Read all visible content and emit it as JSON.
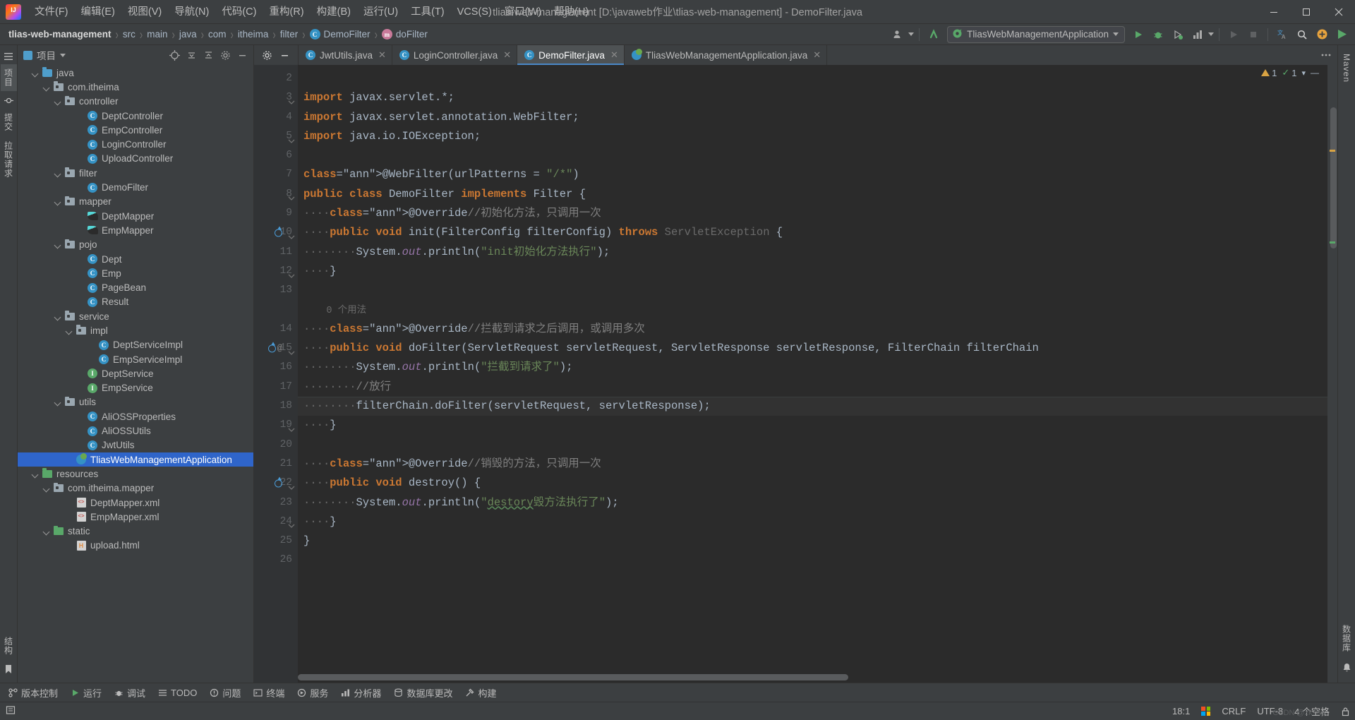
{
  "titlebar": {
    "logo_name": "intellij-idea-logo",
    "menus": [
      {
        "label": "文件(F)",
        "name": "menu-file"
      },
      {
        "label": "编辑(E)",
        "name": "menu-edit"
      },
      {
        "label": "视图(V)",
        "name": "menu-view"
      },
      {
        "label": "导航(N)",
        "name": "menu-navigate"
      },
      {
        "label": "代码(C)",
        "name": "menu-code"
      },
      {
        "label": "重构(R)",
        "name": "menu-refactor"
      },
      {
        "label": "构建(B)",
        "name": "menu-build"
      },
      {
        "label": "运行(U)",
        "name": "menu-run"
      },
      {
        "label": "工具(T)",
        "name": "menu-tools"
      },
      {
        "label": "VCS(S)",
        "name": "menu-vcs"
      },
      {
        "label": "窗口(W)",
        "name": "menu-window"
      },
      {
        "label": "帮助(H)",
        "name": "menu-help"
      }
    ],
    "project_title": "tlias-web-management [D:\\javaweb作业\\tlias-web-management] - DemoFilter.java"
  },
  "navbar": {
    "breadcrumbs": [
      {
        "label": "tlias-web-management",
        "icon": "",
        "name": "breadcrumb-project"
      },
      {
        "label": "src",
        "icon": "",
        "name": "breadcrumb-src"
      },
      {
        "label": "main",
        "icon": "",
        "name": "breadcrumb-main"
      },
      {
        "label": "java",
        "icon": "",
        "name": "breadcrumb-java"
      },
      {
        "label": "com",
        "icon": "",
        "name": "breadcrumb-com"
      },
      {
        "label": "itheima",
        "icon": "",
        "name": "breadcrumb-itheima"
      },
      {
        "label": "filter",
        "icon": "",
        "name": "breadcrumb-filter"
      },
      {
        "label": "DemoFilter",
        "icon": "C",
        "name": "breadcrumb-class"
      },
      {
        "label": "doFilter",
        "icon": "m",
        "name": "breadcrumb-method"
      }
    ],
    "separator": "›",
    "run_config": "TliasWebManagementApplication",
    "icons": {
      "account": "account-icon",
      "updates": "update-arrow-icon",
      "spring_boot": "spring-boot-icon",
      "run": "run-icon",
      "debug": "debug-icon",
      "run_with_coverage": "coverage-icon",
      "profiler": "profiler-icon",
      "rerun": "rerun-icon",
      "stop": "stop-icon",
      "translate": "translate-icon",
      "search": "search-icon",
      "plugins": "plugin-icon",
      "play_green": "play-green-icon",
      "dropdown": "chevron-down-icon"
    }
  },
  "left_strip": {
    "tabs": [
      {
        "label": "项目",
        "name": "tool-tab-project",
        "active": true
      },
      {
        "label": "提交",
        "name": "tool-tab-commit",
        "active": false
      },
      {
        "label": "拉取请求",
        "name": "tool-tab-pull-requests",
        "active": false
      }
    ],
    "bottom": [
      {
        "label": "结构",
        "name": "tool-tab-structure"
      },
      {
        "label": "收藏夹",
        "name": "tool-tab-bookmarks"
      }
    ]
  },
  "right_strip": {
    "tabs": [
      {
        "label": "Maven",
        "name": "tool-tab-maven"
      },
      {
        "label": "数据库",
        "name": "tool-tab-database"
      },
      {
        "label": "通知",
        "name": "tool-tab-notifications"
      }
    ]
  },
  "project_panel": {
    "title": "项目",
    "actions": [
      {
        "name": "select-opened-file-button",
        "icon": "crosshair-icon"
      },
      {
        "name": "expand-all-button",
        "icon": "expand-all-icon"
      },
      {
        "name": "collapse-all-button",
        "icon": "collapse-all-icon"
      },
      {
        "name": "settings-button",
        "icon": "gear-icon"
      },
      {
        "name": "hide-button",
        "icon": "minimize-icon"
      }
    ],
    "tree": [
      {
        "label": "java",
        "icon": "folder-src",
        "indent": 4,
        "arrow": true,
        "selected": false
      },
      {
        "label": "com.itheima",
        "icon": "folder-pkg",
        "indent": 5,
        "arrow": true,
        "selected": false
      },
      {
        "label": "controller",
        "icon": "folder-pkg",
        "indent": 6,
        "arrow": true,
        "selected": false
      },
      {
        "label": "DeptController",
        "icon": "class",
        "indent": 8,
        "arrow": false,
        "selected": false
      },
      {
        "label": "EmpController",
        "icon": "class",
        "indent": 8,
        "arrow": false,
        "selected": false
      },
      {
        "label": "LoginController",
        "icon": "class",
        "indent": 8,
        "arrow": false,
        "selected": false
      },
      {
        "label": "UploadController",
        "icon": "class",
        "indent": 8,
        "arrow": false,
        "selected": false
      },
      {
        "label": "filter",
        "icon": "folder-pkg",
        "indent": 6,
        "arrow": true,
        "selected": false
      },
      {
        "label": "DemoFilter",
        "icon": "class",
        "indent": 8,
        "arrow": false,
        "selected": false
      },
      {
        "label": "mapper",
        "icon": "folder-pkg",
        "indent": 6,
        "arrow": true,
        "selected": false
      },
      {
        "label": "DeptMapper",
        "icon": "mapper",
        "indent": 8,
        "arrow": false,
        "selected": false
      },
      {
        "label": "EmpMapper",
        "icon": "mapper",
        "indent": 8,
        "arrow": false,
        "selected": false
      },
      {
        "label": "pojo",
        "icon": "folder-pkg",
        "indent": 6,
        "arrow": true,
        "selected": false
      },
      {
        "label": "Dept",
        "icon": "class",
        "indent": 8,
        "arrow": false,
        "selected": false
      },
      {
        "label": "Emp",
        "icon": "class",
        "indent": 8,
        "arrow": false,
        "selected": false
      },
      {
        "label": "PageBean",
        "icon": "class",
        "indent": 8,
        "arrow": false,
        "selected": false
      },
      {
        "label": "Result",
        "icon": "class",
        "indent": 8,
        "arrow": false,
        "selected": false
      },
      {
        "label": "service",
        "icon": "folder-pkg",
        "indent": 6,
        "arrow": true,
        "selected": false
      },
      {
        "label": "impl",
        "icon": "folder-pkg",
        "indent": 7,
        "arrow": true,
        "selected": false
      },
      {
        "label": "DeptServiceImpl",
        "icon": "class",
        "indent": 9,
        "arrow": false,
        "selected": false
      },
      {
        "label": "EmpServiceImpl",
        "icon": "class",
        "indent": 9,
        "arrow": false,
        "selected": false
      },
      {
        "label": "DeptService",
        "icon": "interface",
        "indent": 8,
        "arrow": false,
        "selected": false
      },
      {
        "label": "EmpService",
        "icon": "interface",
        "indent": 8,
        "arrow": false,
        "selected": false
      },
      {
        "label": "utils",
        "icon": "folder-pkg",
        "indent": 6,
        "arrow": true,
        "selected": false
      },
      {
        "label": "AliOSSProperties",
        "icon": "class",
        "indent": 8,
        "arrow": false,
        "selected": false
      },
      {
        "label": "AliOSSUtils",
        "icon": "class",
        "indent": 8,
        "arrow": false,
        "selected": false
      },
      {
        "label": "JwtUtils",
        "icon": "class",
        "indent": 8,
        "arrow": false,
        "selected": false
      },
      {
        "label": "TliasWebManagementApplication",
        "icon": "spring",
        "indent": 7,
        "arrow": false,
        "selected": true
      },
      {
        "label": "resources",
        "icon": "folder-res",
        "indent": 4,
        "arrow": true,
        "selected": false
      },
      {
        "label": "com.itheima.mapper",
        "icon": "folder-pkg",
        "indent": 5,
        "arrow": true,
        "selected": false
      },
      {
        "label": "DeptMapper.xml",
        "icon": "xml",
        "indent": 7,
        "arrow": false,
        "selected": false
      },
      {
        "label": "EmpMapper.xml",
        "icon": "xml",
        "indent": 7,
        "arrow": false,
        "selected": false
      },
      {
        "label": "static",
        "icon": "folder-res",
        "indent": 5,
        "arrow": true,
        "selected": false
      },
      {
        "label": "upload.html",
        "icon": "html",
        "indent": 7,
        "arrow": false,
        "selected": false
      }
    ]
  },
  "editor": {
    "tabs": [
      {
        "label": "JwtUtils.java",
        "icon": "java-class-icon",
        "active": false,
        "name": "editor-tab-jwtutils"
      },
      {
        "label": "LoginController.java",
        "icon": "java-class-icon",
        "active": false,
        "name": "editor-tab-logincontroller"
      },
      {
        "label": "DemoFilter.java",
        "icon": "java-class-icon",
        "active": true,
        "name": "editor-tab-demofilter"
      },
      {
        "label": "TliasWebManagementApplication.java",
        "icon": "spring-class-icon",
        "active": false,
        "name": "editor-tab-tliaswebmanagementapplication"
      }
    ],
    "inspection": {
      "warnings": "1",
      "checks": "1"
    },
    "usage_hint": "0 个用法",
    "lines": [
      {
        "num": "2",
        "text": ""
      },
      {
        "num": "3",
        "text": "import javax.servlet.*;"
      },
      {
        "num": "4",
        "text": "import javax.servlet.annotation.WebFilter;"
      },
      {
        "num": "5",
        "text": "import java.io.IOException;"
      },
      {
        "num": "6",
        "text": ""
      },
      {
        "num": "7",
        "text": "@WebFilter(urlPatterns = \"/*\")"
      },
      {
        "num": "8",
        "text": "public class DemoFilter implements Filter {"
      },
      {
        "num": "9",
        "text": "    @Override//初始化方法，只调用一次"
      },
      {
        "num": "10",
        "text": "    public void init(FilterConfig filterConfig) throws ServletException {"
      },
      {
        "num": "11",
        "text": "        System.out.println(\"init初始化方法执行\");"
      },
      {
        "num": "12",
        "text": "    }"
      },
      {
        "num": "13",
        "text": ""
      },
      {
        "num": "",
        "text": "    0 个用法"
      },
      {
        "num": "14",
        "text": "    @Override//拦截到请求之后调用，或调用多次"
      },
      {
        "num": "15",
        "text": "    public void doFilter(ServletRequest servletRequest, ServletResponse servletResponse, FilterChain filterChain"
      },
      {
        "num": "16",
        "text": "        System.out.println(\"拦截到请求了\");"
      },
      {
        "num": "17",
        "text": "        //放行"
      },
      {
        "num": "18",
        "text": "        filterChain.doFilter(servletRequest, servletResponse);"
      },
      {
        "num": "19",
        "text": "    }"
      },
      {
        "num": "20",
        "text": ""
      },
      {
        "num": "21",
        "text": "    @Override//销毁的方法，只调用一次"
      },
      {
        "num": "22",
        "text": "    public void destroy() {"
      },
      {
        "num": "23",
        "text": "        System.out.println(\"destory销毁方法执行了\");"
      },
      {
        "num": "24",
        "text": "    }"
      },
      {
        "num": "25",
        "text": "}"
      },
      {
        "num": "26",
        "text": ""
      }
    ]
  },
  "toolwindow_bar": {
    "items": [
      {
        "label": "版本控制",
        "icon": "branch-icon",
        "name": "toolwindow-version-control"
      },
      {
        "label": "运行",
        "icon": "play-icon",
        "name": "toolwindow-run"
      },
      {
        "label": "调试",
        "icon": "bug-icon",
        "name": "toolwindow-debug"
      },
      {
        "label": "TODO",
        "icon": "list-icon",
        "name": "toolwindow-todo"
      },
      {
        "label": "问题",
        "icon": "warning-icon",
        "name": "toolwindow-problems"
      },
      {
        "label": "终端",
        "icon": "terminal-icon",
        "name": "toolwindow-terminal"
      },
      {
        "label": "服务",
        "icon": "services-icon",
        "name": "toolwindow-services"
      },
      {
        "label": "分析器",
        "icon": "profiler-icon",
        "name": "toolwindow-profiler"
      },
      {
        "label": "数据库更改",
        "icon": "database-icon",
        "name": "toolwindow-database-changes"
      },
      {
        "label": "构建",
        "icon": "hammer-icon",
        "name": "toolwindow-build"
      }
    ]
  },
  "statusbar": {
    "caret": "18:1",
    "line_separator": "CRLF",
    "encoding": "UTF-8",
    "indent": "4 个空格",
    "watermark": "CSDN @zk7ap",
    "icons": {
      "memory": "memory-indicator",
      "windows": "windows-logo-icon",
      "lock": "lock-icon"
    }
  },
  "colors": {
    "bg_panel": "#3c3f41",
    "bg_editor": "#2b2b2b",
    "gutter": "#313335",
    "accent_blue": "#3592c4",
    "accent_green": "#59a869",
    "selection": "#2f65ca",
    "keyword": "#cc7832",
    "annotation": "#bbb529",
    "string": "#6a8759",
    "comment": "#808080",
    "field": "#9876aa"
  }
}
